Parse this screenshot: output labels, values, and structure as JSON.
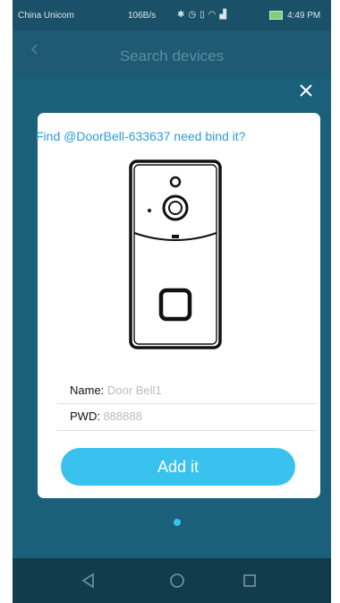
{
  "status_bar": {
    "carrier": "China Unicom",
    "network_speed": "106B/s",
    "time": "4:49 PM",
    "icons": [
      "bluetooth-icon",
      "alarm-icon",
      "vibrate-icon",
      "wifi-icon",
      "signal-icon",
      "battery-icon"
    ]
  },
  "app_bar": {
    "title": "Search devices"
  },
  "dialog": {
    "prompt": "Find @DoorBell-633637 need bind it?",
    "name_label": "Name:",
    "name_value": "Door Bell1",
    "pwd_label": "PWD:",
    "pwd_value": "888888",
    "add_button": "Add it"
  },
  "pager": {
    "count": 1,
    "current": 1
  },
  "colors": {
    "accent": "#39c2ee",
    "prompt_text": "#2a9be0",
    "background": "#1a607a"
  }
}
